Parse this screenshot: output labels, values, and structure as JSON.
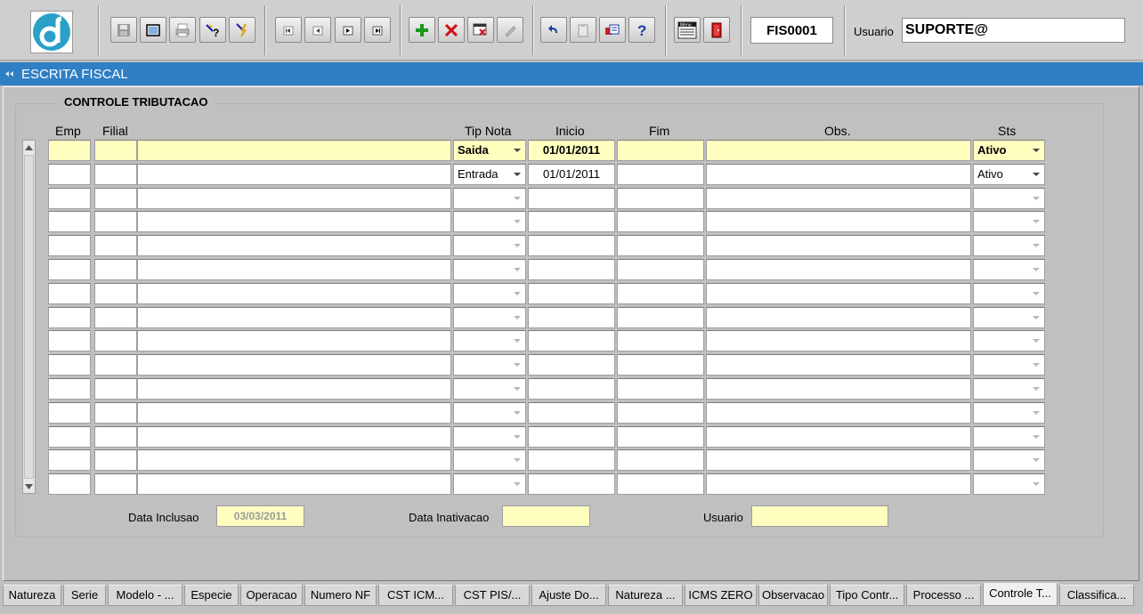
{
  "toolbar": {
    "form_code": "FIS0001",
    "user_label": "Usuario",
    "user_value": "SUPORTE@"
  },
  "window": {
    "title": "ESCRITA FISCAL"
  },
  "frame": {
    "title": "CONTROLE TRIBUTACAO",
    "columns": {
      "emp": "Emp",
      "filial": "Filial",
      "tip_nota": "Tip Nota",
      "inicio": "Inicio",
      "fim": "Fim",
      "obs": "Obs.",
      "sts": "Sts"
    },
    "rows": [
      {
        "emp": "",
        "filial": "",
        "desc": "",
        "tip_nota": "Saida",
        "inicio": "01/01/2011",
        "fim": "",
        "obs": "",
        "sts": "Ativo"
      },
      {
        "emp": "",
        "filial": "",
        "desc": "",
        "tip_nota": "Entrada",
        "inicio": "01/01/2011",
        "fim": "",
        "obs": "",
        "sts": "Ativo"
      },
      {
        "emp": "",
        "filial": "",
        "desc": "",
        "tip_nota": "",
        "inicio": "",
        "fim": "",
        "obs": "",
        "sts": ""
      },
      {
        "emp": "",
        "filial": "",
        "desc": "",
        "tip_nota": "",
        "inicio": "",
        "fim": "",
        "obs": "",
        "sts": ""
      },
      {
        "emp": "",
        "filial": "",
        "desc": "",
        "tip_nota": "",
        "inicio": "",
        "fim": "",
        "obs": "",
        "sts": ""
      },
      {
        "emp": "",
        "filial": "",
        "desc": "",
        "tip_nota": "",
        "inicio": "",
        "fim": "",
        "obs": "",
        "sts": ""
      },
      {
        "emp": "",
        "filial": "",
        "desc": "",
        "tip_nota": "",
        "inicio": "",
        "fim": "",
        "obs": "",
        "sts": ""
      },
      {
        "emp": "",
        "filial": "",
        "desc": "",
        "tip_nota": "",
        "inicio": "",
        "fim": "",
        "obs": "",
        "sts": ""
      },
      {
        "emp": "",
        "filial": "",
        "desc": "",
        "tip_nota": "",
        "inicio": "",
        "fim": "",
        "obs": "",
        "sts": ""
      },
      {
        "emp": "",
        "filial": "",
        "desc": "",
        "tip_nota": "",
        "inicio": "",
        "fim": "",
        "obs": "",
        "sts": ""
      },
      {
        "emp": "",
        "filial": "",
        "desc": "",
        "tip_nota": "",
        "inicio": "",
        "fim": "",
        "obs": "",
        "sts": ""
      },
      {
        "emp": "",
        "filial": "",
        "desc": "",
        "tip_nota": "",
        "inicio": "",
        "fim": "",
        "obs": "",
        "sts": ""
      },
      {
        "emp": "",
        "filial": "",
        "desc": "",
        "tip_nota": "",
        "inicio": "",
        "fim": "",
        "obs": "",
        "sts": ""
      },
      {
        "emp": "",
        "filial": "",
        "desc": "",
        "tip_nota": "",
        "inicio": "",
        "fim": "",
        "obs": "",
        "sts": ""
      },
      {
        "emp": "",
        "filial": "",
        "desc": "",
        "tip_nota": "",
        "inicio": "",
        "fim": "",
        "obs": "",
        "sts": ""
      }
    ]
  },
  "footer": {
    "data_inclusao_label": "Data Inclusao",
    "data_inclusao_value": "03/03/2011",
    "data_inativacao_label": "Data Inativacao",
    "data_inativacao_value": "",
    "usuario_label": "Usuario",
    "usuario_value": ""
  },
  "tabs": [
    {
      "label": "Natureza"
    },
    {
      "label": "Serie"
    },
    {
      "label": "Modelo - ..."
    },
    {
      "label": "Especie"
    },
    {
      "label": "Operacao"
    },
    {
      "label": "Numero NF"
    },
    {
      "label": "CST ICM..."
    },
    {
      "label": "CST PIS/..."
    },
    {
      "label": "Ajuste Do..."
    },
    {
      "label": "Natureza ..."
    },
    {
      "label": "ICMS ZERO"
    },
    {
      "label": "Observacao"
    },
    {
      "label": "Tipo Contr..."
    },
    {
      "label": "Processo ..."
    },
    {
      "label": "Controle T..."
    },
    {
      "label": "Classifica..."
    }
  ],
  "active_tab": "Controle T...",
  "colors": {
    "title_bar": "#2e7fc4",
    "selected_row": "#ffffc0",
    "logo": "#2aa0c8"
  }
}
